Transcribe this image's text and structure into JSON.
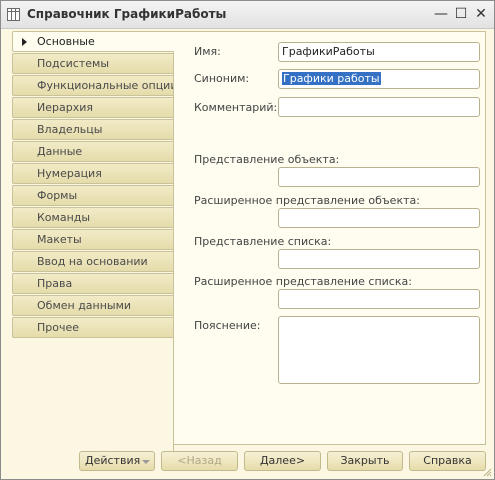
{
  "window": {
    "title": "Справочник ГрафикиРаботы",
    "minimize_glyph": "—",
    "maximize_glyph": "☐",
    "close_glyph": "✕"
  },
  "sidebar": {
    "items": [
      {
        "label": "Основные",
        "active": true
      },
      {
        "label": "Подсистемы"
      },
      {
        "label": "Функциональные опции"
      },
      {
        "label": "Иерархия"
      },
      {
        "label": "Владельцы"
      },
      {
        "label": "Данные"
      },
      {
        "label": "Нумерация"
      },
      {
        "label": "Формы"
      },
      {
        "label": "Команды"
      },
      {
        "label": "Макеты"
      },
      {
        "label": "Ввод на основании"
      },
      {
        "label": "Права"
      },
      {
        "label": "Обмен данными"
      },
      {
        "label": "Прочее"
      }
    ]
  },
  "form": {
    "name_label": "Имя:",
    "name_value": "ГрафикиРаботы",
    "synonym_label": "Синоним:",
    "synonym_value": "Графики работы",
    "comment_label": "Комментарий:",
    "comment_value": "",
    "object_repr_label": "Представление объекта:",
    "object_repr_value": "",
    "ext_object_repr_label": "Расширенное представление объекта:",
    "ext_object_repr_value": "",
    "list_repr_label": "Представление списка:",
    "list_repr_value": "",
    "ext_list_repr_label": "Расширенное представление списка:",
    "ext_list_repr_value": "",
    "explanation_label": "Пояснение:",
    "explanation_value": ""
  },
  "footer": {
    "actions_label": "Действия",
    "back_label": "<Назад",
    "next_label": "Далее>",
    "close_label": "Закрыть",
    "help_label": "Справка"
  }
}
